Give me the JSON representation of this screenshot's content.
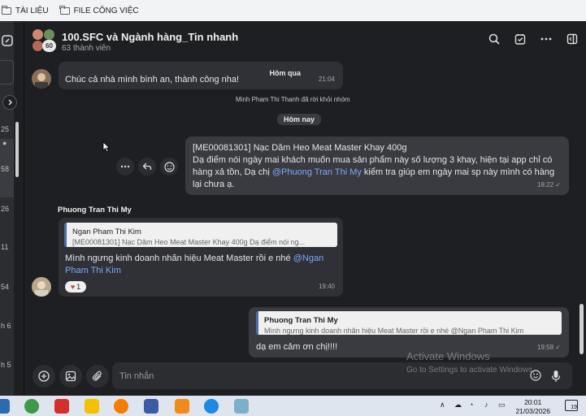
{
  "bookmarks": [
    {
      "label": "TÀI LIỆU"
    },
    {
      "label": "FILE CÔNG VIỆC"
    }
  ],
  "left_rail": {
    "times": [
      "25",
      "58",
      "26",
      "11",
      "54",
      "h 6",
      "h 5"
    ]
  },
  "header": {
    "group_name": "100.SFC và Ngành hàng_Tin nhanh",
    "member_count": "63 thành viên",
    "avatar_count": "60"
  },
  "messages": {
    "m1": {
      "sender_label": "Hôm qua",
      "text": "Chúc cả nhà mình bình an, thành công nha!",
      "time": "21:04"
    },
    "system_notice": "Minh Pham Thi Thanh đã rời khỏi nhóm",
    "date_divider": "Hôm nay",
    "m2": {
      "line1": "[ME00081301] Nạc Dăm Heo Meat Master Khay 400g",
      "line2": "Dạ điểm nói ngày mai khách muốn mua sản phẩm này số lượng 3 khay, hiện tại app chỉ có",
      "line3a": "hàng xả tồn, Dạ chị ",
      "mention": "@Phuong Tran Thi My",
      "line3b": " kiểm tra giúp em ngày mai sp này mình có hàng",
      "line4": "lại chưa ạ.",
      "time": "18:22"
    },
    "m3": {
      "sender": "Phuong Tran Thi My",
      "quote_name": "Ngan Pham Thi Kim",
      "quote_text": "[ME00081301] Nạc Dăm Heo Meat Master Khay 400g Dạ điểm nói ng...",
      "text_a": "Mình ngưng kinh doanh nhãn hiệu Meat Master rồi e nhé ",
      "mention_a": "@Ngan",
      "mention_b": "Pham Thi Kim",
      "reaction_count": "1",
      "time": "19:40"
    },
    "m4": {
      "quote_name": "Phuong Tran Thi My",
      "quote_text": "Mình ngưng kinh doanh nhãn hiệu Meat Master rồi e nhé @Ngan Pham Thi Kim",
      "text": "dạ em cảm ơn chị!!!!",
      "time": "19:58"
    }
  },
  "composer": {
    "placeholder": "Tin nhắn"
  },
  "watermark": {
    "title": "Activate Windows",
    "subtitle": "Go to Settings to activate Windows."
  },
  "taskbar": {
    "time": "20:01",
    "date": "21/03/2026",
    "badge": "19"
  }
}
